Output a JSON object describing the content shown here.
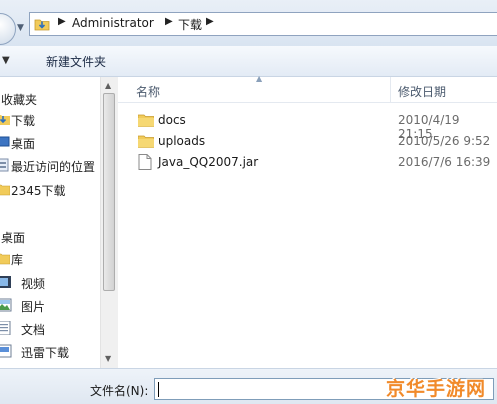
{
  "address_bar": {
    "crumbs": [
      "Administrator",
      "下载"
    ],
    "colors": {
      "folder": "#4a86c8"
    }
  },
  "toolbar": {
    "new_folder_label": "新建文件夹"
  },
  "sidebar": {
    "items": [
      {
        "label": "收藏夹",
        "icon": "star-icon",
        "head": true
      },
      {
        "label": "下载",
        "icon": "download-folder-icon"
      },
      {
        "label": "桌面",
        "icon": "desktop-icon"
      },
      {
        "label": "最近访问的位置",
        "icon": "recent-places-icon"
      },
      {
        "label": "2345下载",
        "icon": "folder-icon"
      },
      {
        "label": "桌面",
        "icon": "desktop-icon",
        "head": true
      },
      {
        "label": "库",
        "icon": "library-icon"
      },
      {
        "label": "视频",
        "icon": "video-icon"
      },
      {
        "label": "图片",
        "icon": "picture-icon"
      },
      {
        "label": "文档",
        "icon": "document-icon"
      },
      {
        "label": "迅雷下载",
        "icon": "thunder-download-icon"
      }
    ]
  },
  "columns": {
    "name": "名称",
    "date": "修改日期"
  },
  "files": [
    {
      "name": "docs",
      "date": "2010/4/19 21:15",
      "icon": "folder-icon"
    },
    {
      "name": "uploads",
      "date": "2010/5/26 9:52",
      "icon": "folder-icon"
    },
    {
      "name": "Java_QQ2007.jar",
      "date": "2016/7/6 16:39",
      "icon": "file-icon"
    }
  ],
  "bottom": {
    "filename_label": "文件名(N):",
    "filename_value": ""
  },
  "watermark": {
    "text": "京华手游网",
    "color": "#f18a2a"
  }
}
